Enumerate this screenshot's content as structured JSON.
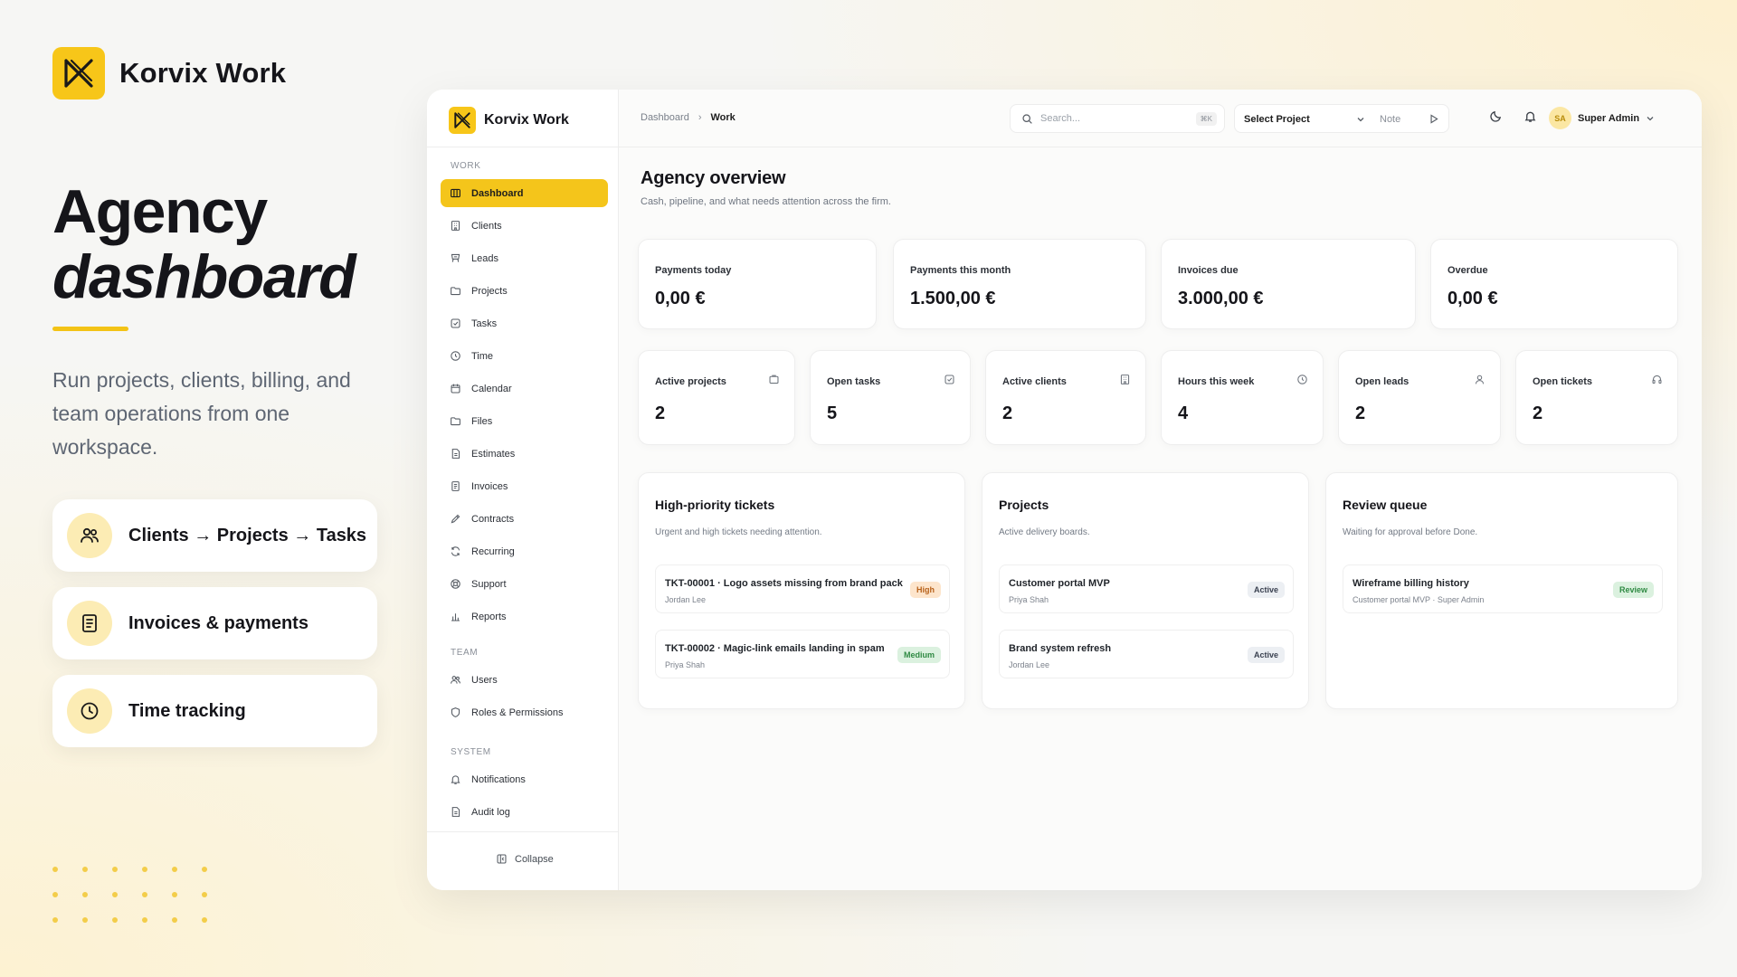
{
  "brand": {
    "name": "Korvix Work",
    "accent": "#F4C51B"
  },
  "hero": {
    "title_line1": "Agency",
    "title_line2": "dashboard",
    "description": "Run projects, clients, billing, and team operations from one workspace."
  },
  "features": [
    {
      "icon": "users-icon",
      "label": "Clients → Projects → Tasks"
    },
    {
      "icon": "invoice-icon",
      "label": "Invoices & payments"
    },
    {
      "icon": "clock-icon",
      "label": "Time tracking"
    }
  ],
  "app": {
    "brand_name": "Korvix Work",
    "sidebar": {
      "sections": {
        "work": "WORK",
        "team": "TEAM",
        "system": "SYSTEM"
      },
      "work_items": [
        {
          "label": "Dashboard",
          "icon": "dashboard-icon",
          "active": true
        },
        {
          "label": "Clients",
          "icon": "building-icon"
        },
        {
          "label": "Leads",
          "icon": "leads-icon"
        },
        {
          "label": "Projects",
          "icon": "folder-icon"
        },
        {
          "label": "Tasks",
          "icon": "checkbox-icon"
        },
        {
          "label": "Time",
          "icon": "clock-icon"
        },
        {
          "label": "Calendar",
          "icon": "calendar-icon"
        },
        {
          "label": "Files",
          "icon": "folder-icon"
        },
        {
          "label": "Estimates",
          "icon": "document-icon"
        },
        {
          "label": "Invoices",
          "icon": "invoice-icon"
        },
        {
          "label": "Contracts",
          "icon": "contract-icon"
        },
        {
          "label": "Recurring",
          "icon": "recurring-icon"
        },
        {
          "label": "Support",
          "icon": "support-icon"
        },
        {
          "label": "Reports",
          "icon": "chart-icon"
        }
      ],
      "team_items": [
        {
          "label": "Users",
          "icon": "users-icon"
        },
        {
          "label": "Roles & Permissions",
          "icon": "shield-icon"
        }
      ],
      "system_items": [
        {
          "label": "Notifications",
          "icon": "bell-icon"
        },
        {
          "label": "Audit log",
          "icon": "document-icon"
        }
      ],
      "collapse_label": "Collapse"
    },
    "topbar": {
      "breadcrumb": [
        "Dashboard",
        "Work"
      ],
      "search_placeholder": "Search...",
      "search_shortcut": "⌘K",
      "project_select": "Select Project",
      "note_placeholder": "Note",
      "user_initials": "SA",
      "user_name": "Super Admin"
    },
    "overview": {
      "title": "Agency overview",
      "subtitle": "Cash, pipeline, and what needs attention across the firm."
    },
    "kpis": [
      {
        "label": "Payments today",
        "value": "0,00 €"
      },
      {
        "label": "Payments this month",
        "value": "1.500,00 €"
      },
      {
        "label": "Invoices due",
        "value": "3.000,00 €"
      },
      {
        "label": "Overdue",
        "value": "0,00 €"
      }
    ],
    "stats": [
      {
        "label": "Active projects",
        "value": "2",
        "icon": "folder-icon"
      },
      {
        "label": "Open tasks",
        "value": "5",
        "icon": "checkbox-icon"
      },
      {
        "label": "Active clients",
        "value": "2",
        "icon": "building-icon"
      },
      {
        "label": "Hours this week",
        "value": "4",
        "icon": "clock-icon"
      },
      {
        "label": "Open leads",
        "value": "2",
        "icon": "user-icon"
      },
      {
        "label": "Open tickets",
        "value": "2",
        "icon": "headset-icon"
      }
    ],
    "panels": {
      "tickets": {
        "title": "High-priority tickets",
        "subtitle": "Urgent and high tickets needing attention.",
        "rows": [
          {
            "title": "TKT-00001 · Logo assets missing from brand pack",
            "meta": "Jordan Lee",
            "badge": "High"
          },
          {
            "title": "TKT-00002 · Magic-link emails landing in spam",
            "meta": "Priya Shah",
            "badge": "Medium"
          }
        ]
      },
      "projects": {
        "title": "Projects",
        "subtitle": "Active delivery boards.",
        "rows": [
          {
            "title": "Customer portal MVP",
            "meta": "Priya Shah",
            "badge": "Active"
          },
          {
            "title": "Brand system refresh",
            "meta": "Jordan Lee",
            "badge": "Active"
          }
        ]
      },
      "review": {
        "title": "Review queue",
        "subtitle": "Waiting for approval before Done.",
        "rows": [
          {
            "title": "Wireframe billing history",
            "meta": "Customer portal MVP · Super Admin",
            "badge": "Review"
          }
        ]
      }
    }
  }
}
